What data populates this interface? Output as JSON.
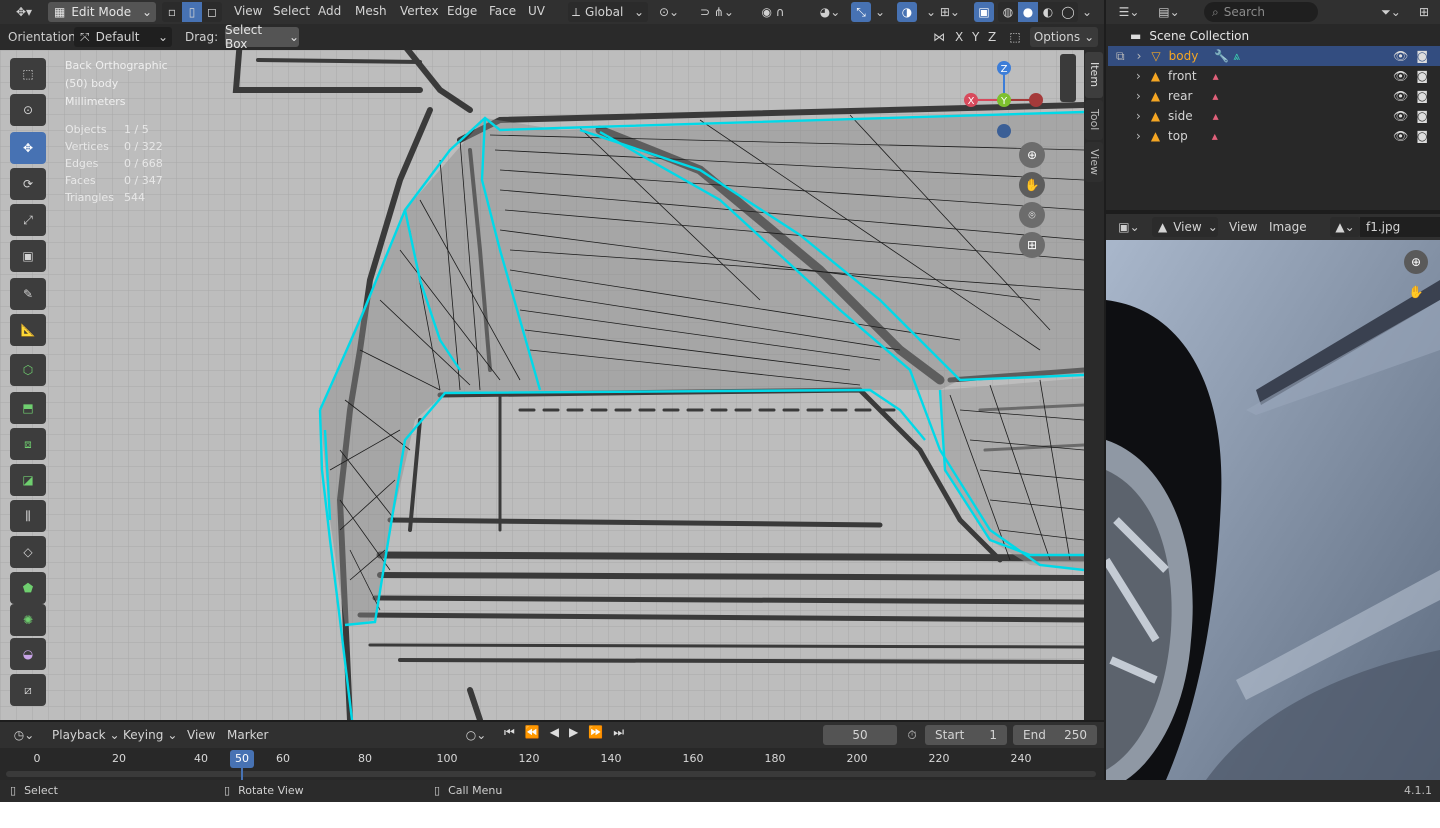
{
  "topbar": {
    "mode": "Edit Mode",
    "menus": [
      "View",
      "Select",
      "Add",
      "Mesh",
      "Vertex",
      "Edge",
      "Face",
      "UV"
    ],
    "transform_orientation": "Global"
  },
  "header2": {
    "orientation_label": "Orientation:",
    "orientation_value": "Default",
    "drag_label": "Drag:",
    "drag_value": "Select Box",
    "axes": [
      "X",
      "Y",
      "Z"
    ],
    "options": "Options"
  },
  "viewport": {
    "view_name": "Back Orthographic",
    "object": "(50) body",
    "units": "Millimeters",
    "stats": [
      {
        "label": "Objects",
        "value": "1 / 5"
      },
      {
        "label": "Vertices",
        "value": "0 / 322"
      },
      {
        "label": "Edges",
        "value": "0 / 668"
      },
      {
        "label": "Faces",
        "value": "0 / 347"
      },
      {
        "label": "Triangles",
        "value": "544"
      }
    ],
    "side_tabs": [
      "Item",
      "Tool",
      "View"
    ],
    "gizmo": {
      "z": "Z",
      "y": "Y",
      "x": "X"
    }
  },
  "outliner": {
    "search_placeholder": "Search",
    "root": "Scene Collection",
    "items": [
      {
        "name": "body",
        "selected": true
      },
      {
        "name": "front",
        "selected": false
      },
      {
        "name": "rear",
        "selected": false
      },
      {
        "name": "side",
        "selected": false
      },
      {
        "name": "top",
        "selected": false
      }
    ]
  },
  "image_editor": {
    "view_mode": "View",
    "menus": [
      "View",
      "Image"
    ],
    "image_name": "f1.jpg"
  },
  "timeline": {
    "menus": [
      "Playback",
      "Keying",
      "View",
      "Marker"
    ],
    "current_frame": "50",
    "start_label": "Start",
    "start": "1",
    "end_label": "End",
    "end": "250",
    "ruler": [
      "0",
      "20",
      "40",
      "50",
      "60",
      "80",
      "100",
      "120",
      "140",
      "160",
      "180",
      "200",
      "220",
      "240"
    ]
  },
  "statusbar": {
    "select": "Select",
    "rotate": "Rotate View",
    "call_menu": "Call Menu",
    "version": "4.1.1"
  },
  "colors": {
    "accent": "#4772b3",
    "wire_selected": "#00d9e8",
    "object_selected": "#f5a623"
  }
}
